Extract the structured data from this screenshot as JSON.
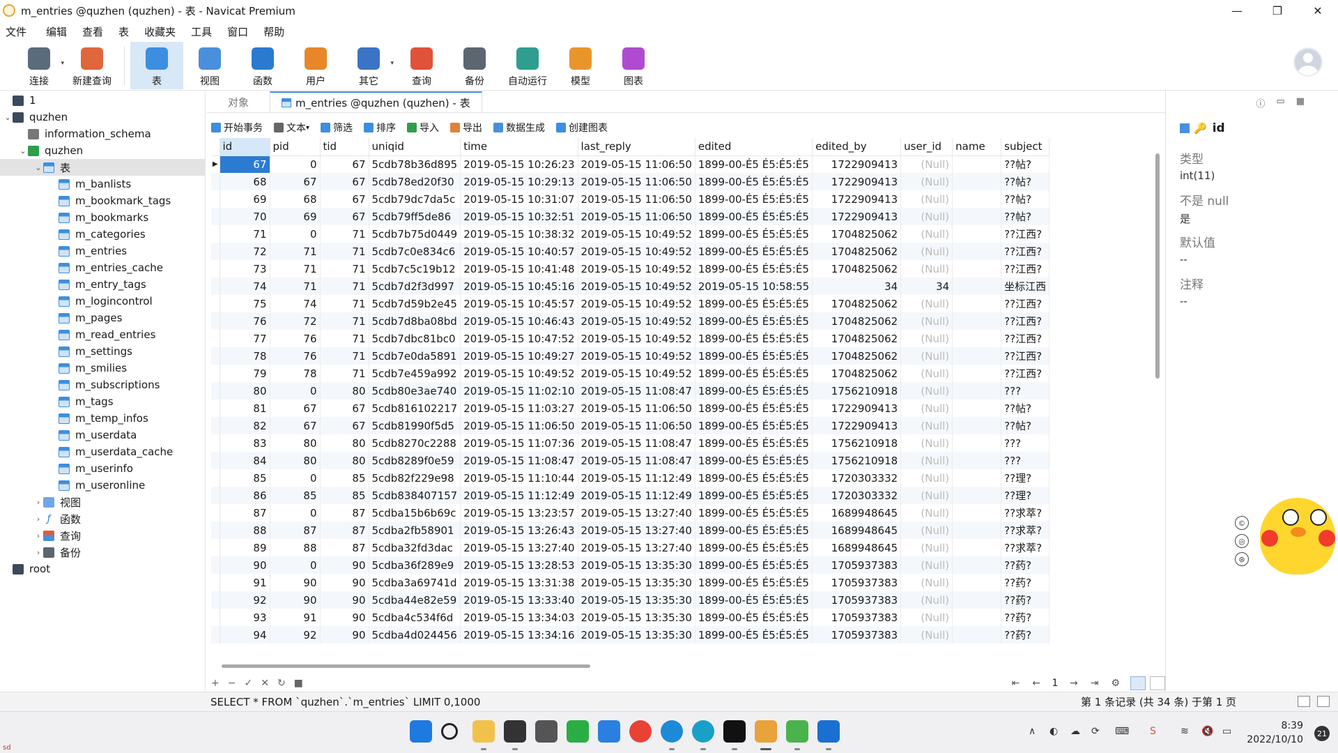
{
  "window": {
    "title": "m_entries @quzhen (quzhen) - 表 - Navicat Premium",
    "minimize": "—",
    "restore": "❐",
    "close": "✕"
  },
  "menu": [
    "文件",
    "编辑",
    "查看",
    "表",
    "收藏夹",
    "工具",
    "窗口",
    "帮助"
  ],
  "toolbar": {
    "buttons": [
      {
        "label": "连接",
        "icon": "connection-icon",
        "color": "#5a6b7c"
      },
      {
        "label": "新建查询",
        "icon": "new-query-icon",
        "color": "#e0663d"
      },
      {
        "label": "表",
        "icon": "table-icon",
        "color": "#3d8ee0"
      },
      {
        "label": "视图",
        "icon": "view-icon",
        "color": "#4a8fdc"
      },
      {
        "label": "函数",
        "icon": "function-icon",
        "color": "#2a7ad0"
      },
      {
        "label": "用户",
        "icon": "user-icon",
        "color": "#e8862a"
      },
      {
        "label": "其它",
        "icon": "other-icon",
        "color": "#3b74c5"
      },
      {
        "label": "查询",
        "icon": "query-icon",
        "color": "#e0523a"
      },
      {
        "label": "备份",
        "icon": "backup-icon",
        "color": "#5c6670"
      },
      {
        "label": "自动运行",
        "icon": "automation-icon",
        "color": "#2f9e8f"
      },
      {
        "label": "模型",
        "icon": "model-icon",
        "color": "#e8962a"
      },
      {
        "label": "图表",
        "icon": "chart-icon",
        "color": "#b04ad0"
      }
    ]
  },
  "sidebar": {
    "nodes": [
      {
        "label": "1",
        "level": 0,
        "arrow": "",
        "icon": "conn"
      },
      {
        "label": "quzhen",
        "level": 0,
        "arrow": "⌄",
        "icon": "conn"
      },
      {
        "label": "information_schema",
        "level": 1,
        "arrow": "",
        "icon": "db-gray"
      },
      {
        "label": "quzhen",
        "level": 1,
        "arrow": "⌄",
        "icon": "db-green"
      },
      {
        "label": "表",
        "level": 2,
        "arrow": "⌄",
        "icon": "table",
        "selected": true
      },
      {
        "label": "m_banlists",
        "level": 3,
        "arrow": "",
        "icon": "table"
      },
      {
        "label": "m_bookmark_tags",
        "level": 3,
        "arrow": "",
        "icon": "table"
      },
      {
        "label": "m_bookmarks",
        "level": 3,
        "arrow": "",
        "icon": "table"
      },
      {
        "label": "m_categories",
        "level": 3,
        "arrow": "",
        "icon": "table"
      },
      {
        "label": "m_entries",
        "level": 3,
        "arrow": "",
        "icon": "table"
      },
      {
        "label": "m_entries_cache",
        "level": 3,
        "arrow": "",
        "icon": "table"
      },
      {
        "label": "m_entry_tags",
        "level": 3,
        "arrow": "",
        "icon": "table"
      },
      {
        "label": "m_logincontrol",
        "level": 3,
        "arrow": "",
        "icon": "table"
      },
      {
        "label": "m_pages",
        "level": 3,
        "arrow": "",
        "icon": "table"
      },
      {
        "label": "m_read_entries",
        "level": 3,
        "arrow": "",
        "icon": "table"
      },
      {
        "label": "m_settings",
        "level": 3,
        "arrow": "",
        "icon": "table"
      },
      {
        "label": "m_smilies",
        "level": 3,
        "arrow": "",
        "icon": "table"
      },
      {
        "label": "m_subscriptions",
        "level": 3,
        "arrow": "",
        "icon": "table"
      },
      {
        "label": "m_tags",
        "level": 3,
        "arrow": "",
        "icon": "table"
      },
      {
        "label": "m_temp_infos",
        "level": 3,
        "arrow": "",
        "icon": "table"
      },
      {
        "label": "m_userdata",
        "level": 3,
        "arrow": "",
        "icon": "table"
      },
      {
        "label": "m_userdata_cache",
        "level": 3,
        "arrow": "",
        "icon": "table"
      },
      {
        "label": "m_userinfo",
        "level": 3,
        "arrow": "",
        "icon": "table"
      },
      {
        "label": "m_useronline",
        "level": 3,
        "arrow": "",
        "icon": "table"
      },
      {
        "label": "视图",
        "level": 2,
        "arrow": "›",
        "icon": "view"
      },
      {
        "label": "函数",
        "level": 2,
        "arrow": "›",
        "icon": "func"
      },
      {
        "label": "查询",
        "level": 2,
        "arrow": "›",
        "icon": "query"
      },
      {
        "label": "备份",
        "level": 2,
        "arrow": "›",
        "icon": "backup"
      },
      {
        "label": "root",
        "level": 0,
        "arrow": "",
        "icon": "conn"
      }
    ]
  },
  "tabs": {
    "objects": "对象",
    "active": "m_entries @quzhen (quzhen) - 表"
  },
  "subtoolbar": [
    {
      "label": "开始事务",
      "icon": "transaction-icon",
      "color": "#3d8ee0"
    },
    {
      "label": "文本",
      "icon": "text-icon",
      "color": "#666",
      "caret": true
    },
    {
      "label": "筛选",
      "icon": "filter-icon",
      "color": "#3d8ee0"
    },
    {
      "label": "排序",
      "icon": "sort-icon",
      "color": "#3d8ee0"
    },
    {
      "label": "导入",
      "icon": "import-icon",
      "color": "#2e9e4a"
    },
    {
      "label": "导出",
      "icon": "export-icon",
      "color": "#e0823a"
    },
    {
      "label": "数据生成",
      "icon": "data-generation-icon",
      "color": "#4a8fdc"
    },
    {
      "label": "创建图表",
      "icon": "create-chart-icon",
      "color": "#3d8ee0"
    }
  ],
  "grid": {
    "columns": [
      "id",
      "pid",
      "tid",
      "uniqid",
      "time",
      "last_reply",
      "edited",
      "edited_by",
      "user_id",
      "name",
      "subject"
    ],
    "rows": [
      [
        "67",
        "0",
        "67",
        "5cdb78b36d895",
        "2019-05-15 10:26:23",
        "2019-05-15 11:06:50",
        "1899-00-É5 É5:É5:É5",
        "1722909413",
        "(Null)",
        "",
        "??帖?"
      ],
      [
        "68",
        "67",
        "67",
        "5cdb78ed20f30",
        "2019-05-15 10:29:13",
        "2019-05-15 11:06:50",
        "1899-00-É5 É5:É5:É5",
        "1722909413",
        "(Null)",
        "",
        "??帖?"
      ],
      [
        "69",
        "68",
        "67",
        "5cdb79dc7da5c",
        "2019-05-15 10:31:07",
        "2019-05-15 11:06:50",
        "1899-00-É5 É5:É5:É5",
        "1722909413",
        "(Null)",
        "",
        "??帖?"
      ],
      [
        "70",
        "69",
        "67",
        "5cdb79ff5de86",
        "2019-05-15 10:32:51",
        "2019-05-15 11:06:50",
        "1899-00-É5 É5:É5:É5",
        "1722909413",
        "(Null)",
        "",
        "??帖?"
      ],
      [
        "71",
        "0",
        "71",
        "5cdb7b75d0449",
        "2019-05-15 10:38:32",
        "2019-05-15 10:49:52",
        "1899-00-É5 É5:É5:É5",
        "1704825062",
        "(Null)",
        "",
        "??江西?"
      ],
      [
        "72",
        "71",
        "71",
        "5cdb7c0e834c6",
        "2019-05-15 10:40:57",
        "2019-05-15 10:49:52",
        "1899-00-É5 É5:É5:É5",
        "1704825062",
        "(Null)",
        "",
        "??江西?"
      ],
      [
        "73",
        "71",
        "71",
        "5cdb7c5c19b12",
        "2019-05-15 10:41:48",
        "2019-05-15 10:49:52",
        "1899-00-É5 É5:É5:É5",
        "1704825062",
        "(Null)",
        "",
        "??江西?"
      ],
      [
        "74",
        "71",
        "71",
        "5cdb7d2f3d997",
        "2019-05-15 10:45:16",
        "2019-05-15 10:49:52",
        "2019-05-15 10:58:55",
        "34",
        "34",
        "",
        "坐标江西"
      ],
      [
        "75",
        "74",
        "71",
        "5cdb7d59b2e45",
        "2019-05-15 10:45:57",
        "2019-05-15 10:49:52",
        "1899-00-É5 É5:É5:É5",
        "1704825062",
        "(Null)",
        "",
        "??江西?"
      ],
      [
        "76",
        "72",
        "71",
        "5cdb7d8ba08bd",
        "2019-05-15 10:46:43",
        "2019-05-15 10:49:52",
        "1899-00-É5 É5:É5:É5",
        "1704825062",
        "(Null)",
        "",
        "??江西?"
      ],
      [
        "77",
        "76",
        "71",
        "5cdb7dbc81bc0",
        "2019-05-15 10:47:52",
        "2019-05-15 10:49:52",
        "1899-00-É5 É5:É5:É5",
        "1704825062",
        "(Null)",
        "",
        "??江西?"
      ],
      [
        "78",
        "76",
        "71",
        "5cdb7e0da5891",
        "2019-05-15 10:49:27",
        "2019-05-15 10:49:52",
        "1899-00-É5 É5:É5:É5",
        "1704825062",
        "(Null)",
        "",
        "??江西?"
      ],
      [
        "79",
        "78",
        "71",
        "5cdb7e459a992",
        "2019-05-15 10:49:52",
        "2019-05-15 10:49:52",
        "1899-00-É5 É5:É5:É5",
        "1704825062",
        "(Null)",
        "",
        "??江西?"
      ],
      [
        "80",
        "0",
        "80",
        "5cdb80e3ae740",
        "2019-05-15 11:02:10",
        "2019-05-15 11:08:47",
        "1899-00-É5 É5:É5:É5",
        "1756210918",
        "(Null)",
        "",
        "???"
      ],
      [
        "81",
        "67",
        "67",
        "5cdb816102217",
        "2019-05-15 11:03:27",
        "2019-05-15 11:06:50",
        "1899-00-É5 É5:É5:É5",
        "1722909413",
        "(Null)",
        "",
        "??帖?"
      ],
      [
        "82",
        "67",
        "67",
        "5cdb81990f5d5",
        "2019-05-15 11:06:50",
        "2019-05-15 11:06:50",
        "1899-00-É5 É5:É5:É5",
        "1722909413",
        "(Null)",
        "",
        "??帖?"
      ],
      [
        "83",
        "80",
        "80",
        "5cdb8270c2288",
        "2019-05-15 11:07:36",
        "2019-05-15 11:08:47",
        "1899-00-É5 É5:É5:É5",
        "1756210918",
        "(Null)",
        "",
        "???"
      ],
      [
        "84",
        "80",
        "80",
        "5cdb8289f0e59",
        "2019-05-15 11:08:47",
        "2019-05-15 11:08:47",
        "1899-00-É5 É5:É5:É5",
        "1756210918",
        "(Null)",
        "",
        "???"
      ],
      [
        "85",
        "0",
        "85",
        "5cdb82f229e98",
        "2019-05-15 11:10:44",
        "2019-05-15 11:12:49",
        "1899-00-É5 É5:É5:É5",
        "1720303332",
        "(Null)",
        "",
        "??理?"
      ],
      [
        "86",
        "85",
        "85",
        "5cdb838407157",
        "2019-05-15 11:12:49",
        "2019-05-15 11:12:49",
        "1899-00-É5 É5:É5:É5",
        "1720303332",
        "(Null)",
        "",
        "??理?"
      ],
      [
        "87",
        "0",
        "87",
        "5cdba15b6b69c",
        "2019-05-15 13:23:57",
        "2019-05-15 13:27:40",
        "1899-00-É5 É5:É5:É5",
        "1689948645",
        "(Null)",
        "",
        "??求萃?"
      ],
      [
        "88",
        "87",
        "87",
        "5cdba2fb58901",
        "2019-05-15 13:26:43",
        "2019-05-15 13:27:40",
        "1899-00-É5 É5:É5:É5",
        "1689948645",
        "(Null)",
        "",
        "??求萃?"
      ],
      [
        "89",
        "88",
        "87",
        "5cdba32fd3dac",
        "2019-05-15 13:27:40",
        "2019-05-15 13:27:40",
        "1899-00-É5 É5:É5:É5",
        "1689948645",
        "(Null)",
        "",
        "??求萃?"
      ],
      [
        "90",
        "0",
        "90",
        "5cdba36f289e9",
        "2019-05-15 13:28:53",
        "2019-05-15 13:35:30",
        "1899-00-É5 É5:É5:É5",
        "1705937383",
        "(Null)",
        "",
        "??药?"
      ],
      [
        "91",
        "90",
        "90",
        "5cdba3a69741d",
        "2019-05-15 13:31:38",
        "2019-05-15 13:35:30",
        "1899-00-É5 É5:É5:É5",
        "1705937383",
        "(Null)",
        "",
        "??药?"
      ],
      [
        "92",
        "90",
        "90",
        "5cdba44e82e59",
        "2019-05-15 13:33:40",
        "2019-05-15 13:35:30",
        "1899-00-É5 É5:É5:É5",
        "1705937383",
        "(Null)",
        "",
        "??药?"
      ],
      [
        "93",
        "91",
        "90",
        "5cdba4c534f6d",
        "2019-05-15 13:34:03",
        "2019-05-15 13:35:30",
        "1899-00-É5 É5:É5:É5",
        "1705937383",
        "(Null)",
        "",
        "??药?"
      ],
      [
        "94",
        "92",
        "90",
        "5cdba4d024456",
        "2019-05-15 13:34:16",
        "2019-05-15 13:35:30",
        "1899-00-É5 É5:É5:É5",
        "1705937383",
        "(Null)",
        "",
        "??药?"
      ]
    ],
    "current_row_marker": "▶",
    "highlight_color": "#2c7bd2"
  },
  "gridfoot": {
    "add": "+",
    "remove": "−",
    "apply": "✓",
    "cancel": "✕",
    "refresh": "↻",
    "stop": "■",
    "first": "⇤",
    "prev": "←",
    "page": "1",
    "next": "→",
    "last": "⇥",
    "settings": "⚙"
  },
  "inspector": {
    "field_name": "id",
    "props": [
      {
        "label": "类型",
        "value": "int(11)"
      },
      {
        "label": "不是 null",
        "value": "是"
      },
      {
        "label": "默认值",
        "value": "--"
      },
      {
        "label": "注释",
        "value": "--"
      }
    ],
    "top_icons": [
      "ⓘ",
      "▭",
      "▦"
    ]
  },
  "floaters": [
    "©",
    "◎",
    "⊛"
  ],
  "statusbar": {
    "sql": "SELECT * FROM `quzhen`.`m_entries` LIMIT 0,1000",
    "info": "第 1 条记录 (共 34 条) 于第 1 页"
  },
  "taskbar": {
    "apps": [
      {
        "name": "start-button",
        "color": "#1f7ae0"
      },
      {
        "name": "search-icon",
        "color": "#222"
      },
      {
        "name": "file-explorer-icon",
        "color": "#f2c14a"
      },
      {
        "name": "terminal-icon",
        "color": "#333"
      },
      {
        "name": "app-icon",
        "color": "#555"
      },
      {
        "name": "wechat-icon",
        "color": "#2aae43"
      },
      {
        "name": "app-store-icon",
        "color": "#2b7fe0"
      },
      {
        "name": "chrome-icon",
        "color": "#e94235"
      },
      {
        "name": "edge-icon",
        "color": "#1c8ad6"
      },
      {
        "name": "edge-beta-icon",
        "color": "#19a0c9"
      },
      {
        "name": "typora-icon",
        "color": "#111"
      },
      {
        "name": "navicat-icon",
        "color": "#e8a33a"
      },
      {
        "name": "image-viewer-icon",
        "color": "#4bb34b"
      },
      {
        "name": "app-blue-icon",
        "color": "#1a6fd0"
      }
    ],
    "tray": [
      "∧",
      "◐",
      "☁",
      "⟳",
      "⌨",
      "S",
      "≋",
      "🔇",
      "▭"
    ],
    "time": "8:39",
    "date": "2022/10/10",
    "notifications": "21"
  },
  "corner_text": "sd"
}
